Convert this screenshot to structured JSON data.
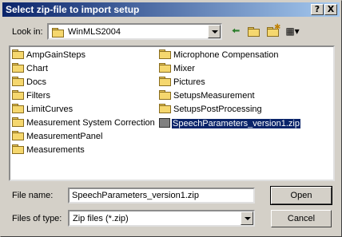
{
  "dialog": {
    "title": "Select zip-file to import setup",
    "help_button": "?",
    "close_button": "X"
  },
  "lookin": {
    "label": "Look in:",
    "value": "WinMLS2004"
  },
  "toolbar": {
    "icons": [
      "back-arrow-icon",
      "up-folder-icon",
      "new-folder-icon",
      "view-menu-icon"
    ]
  },
  "files": {
    "col1": [
      "AmpGainSteps",
      "Chart",
      "Docs",
      "Filters",
      "LimitCurves",
      "Measurement System Correction",
      "MeasurementPanel",
      "Measurements"
    ],
    "col2": [
      "Microphone Compensation",
      "Mixer",
      "Pictures",
      "SetupsMeasurement",
      "SetupsPostProcessing"
    ],
    "selected_file": "SpeechParameters_version1.zip"
  },
  "filename": {
    "label": "File name:",
    "value": "SpeechParameters_version1.zip"
  },
  "filetype": {
    "label": "Files of type:",
    "value": "Zip files (*.zip)"
  },
  "buttons": {
    "open": "Open",
    "cancel": "Cancel"
  }
}
